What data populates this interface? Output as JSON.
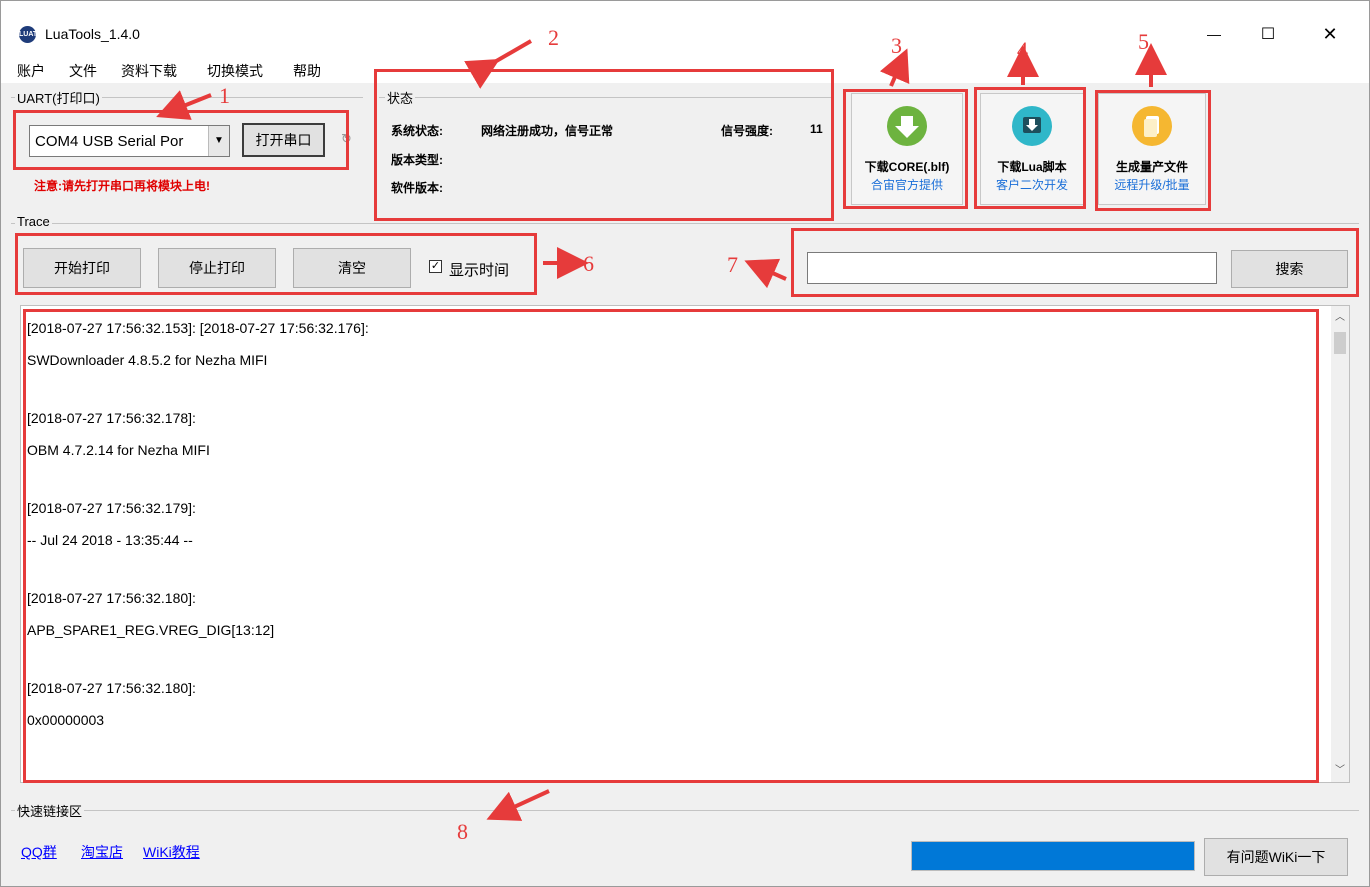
{
  "window": {
    "title": "LuaTools_1.4.0",
    "icon_text": "LUAT",
    "controls": {
      "minimize": "—",
      "maximize": "☐",
      "close": "✕"
    }
  },
  "menu": [
    "账户",
    "文件",
    "资料下载",
    "切换模式",
    "帮助"
  ],
  "uart": {
    "group_label": "UART(打印口)",
    "port_value": "COM4 USB Serial Por",
    "open_button": "打开串口",
    "warning": "注意:请先打开串口再将模块上电!"
  },
  "status": {
    "group_label": "状态",
    "system_label": "系统状态:",
    "system_value": "网络注册成功，信号正常",
    "signal_label": "信号强度:",
    "signal_value": "11",
    "version_type_label": "版本类型:",
    "software_version_label": "软件版本:"
  },
  "tiles": [
    {
      "title": "下载CORE(.blf)",
      "subtitle": "合宙官方提供",
      "icon": "download-arrow-icon",
      "color": "#6db33f"
    },
    {
      "title": "下载Lua脚本",
      "subtitle": "客户二次开发",
      "icon": "download-tray-icon",
      "color": "#2fb7c9"
    },
    {
      "title": "生成量产文件",
      "subtitle": "远程升级/批量",
      "icon": "document-icon",
      "color": "#f5b731"
    }
  ],
  "trace": {
    "group_label": "Trace",
    "start_button": "开始打印",
    "stop_button": "停止打印",
    "clear_button": "清空",
    "show_time_label": "显示时间",
    "show_time_checked": true,
    "search_value": "",
    "search_button": "搜索"
  },
  "log_lines": [
    "[2018-07-27 17:56:32.153]: [2018-07-27 17:56:32.176]:",
    "SWDownloader 4.8.5.2 for Nezha MIFI",
    "",
    "[2018-07-27 17:56:32.178]:",
    "OBM 4.7.2.14 for Nezha MIFI",
    "",
    "[2018-07-27 17:56:32.179]:",
    "-- Jul 24 2018 - 13:35:44 --",
    "",
    "[2018-07-27 17:56:32.180]:",
    "APB_SPARE1_REG.VREG_DIG[13:12]",
    "",
    "[2018-07-27 17:56:32.180]:",
    "0x00000003"
  ],
  "quick_links": {
    "group_label": "快速链接区",
    "links": [
      "QQ群",
      "淘宝店",
      "WiKi教程"
    ],
    "progress": 1.0,
    "wiki_button": "有问题WiKi一下"
  },
  "annotations": [
    "1",
    "2",
    "3",
    "4",
    "5",
    "6",
    "7",
    "8"
  ],
  "colors": {
    "annotation": "#e63b3b",
    "progress": "#0078d7",
    "link": "#0000ff",
    "warning": "#e00000"
  }
}
